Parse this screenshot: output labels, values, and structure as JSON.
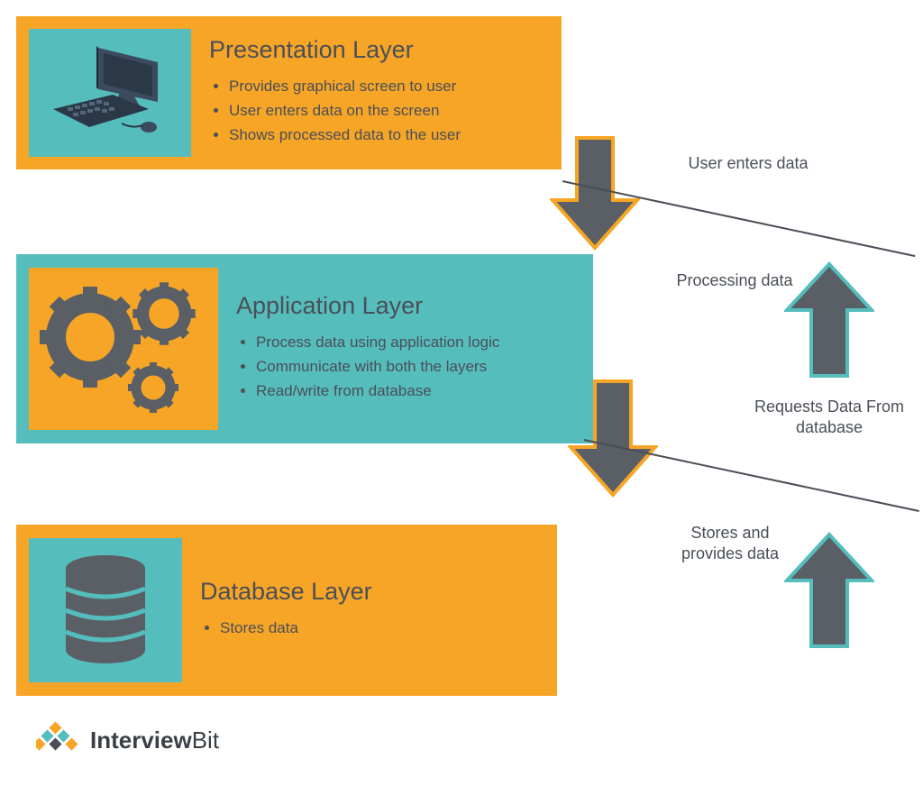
{
  "layers": {
    "presentation": {
      "title": "Presentation Layer",
      "bullets": [
        "Provides graphical screen to user",
        "User enters data on the screen",
        "Shows processed data to the user"
      ]
    },
    "application": {
      "title": "Application Layer",
      "bullets": [
        "Process data using application logic",
        "Communicate with both the layers",
        "Read/write from database"
      ]
    },
    "database": {
      "title": "Database Layer",
      "bullets": [
        "Stores data"
      ]
    }
  },
  "flows": {
    "user_enters": "User enters data",
    "processing": "Processing data",
    "requests": "Requests Data From database",
    "stores": "Stores and provides data"
  },
  "brand": {
    "part1": "Interview",
    "part2": "Bit"
  },
  "colors": {
    "orange": "#f6a527",
    "teal": "#56bdbd",
    "slate": "#5a5f66",
    "text": "#4a4f57"
  }
}
